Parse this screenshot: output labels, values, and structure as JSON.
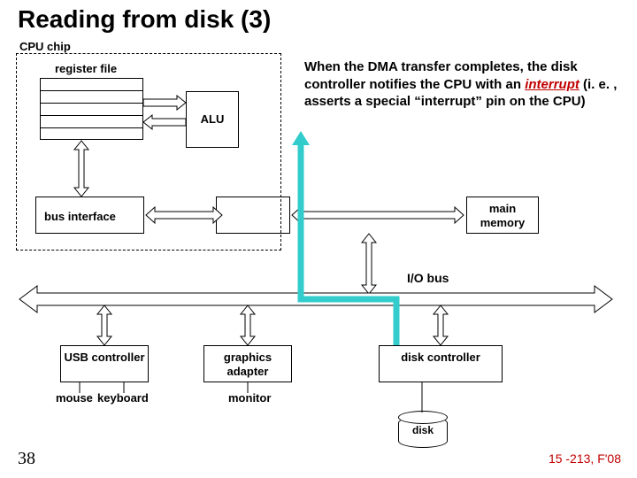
{
  "title": "Reading from disk (3)",
  "cpu_chip_label": "CPU chip",
  "register_file_label": "register file",
  "alu_label": "ALU",
  "caption_text_1": "When the DMA transfer completes, the disk controller notifies the CPU with an ",
  "caption_em": "interrupt",
  "caption_text_2": " (i. e. , asserts a special “interrupt” pin on the CPU)",
  "bus_interface_label": "bus interface",
  "main_memory_label": "main memory",
  "io_bus_label": "I/O bus",
  "usb_label": "USB controller",
  "graphics_label": "graphics adapter",
  "disk_ctrl_label": "disk controller",
  "mouse_label": "mouse",
  "keyboard_label": "keyboard",
  "monitor_label": "monitor",
  "disk_label": "disk",
  "slide_number": "38",
  "course_footer": "15 -213, F'08",
  "colors": {
    "accent": "#c00000",
    "interrupt_path": "#33cccc"
  }
}
